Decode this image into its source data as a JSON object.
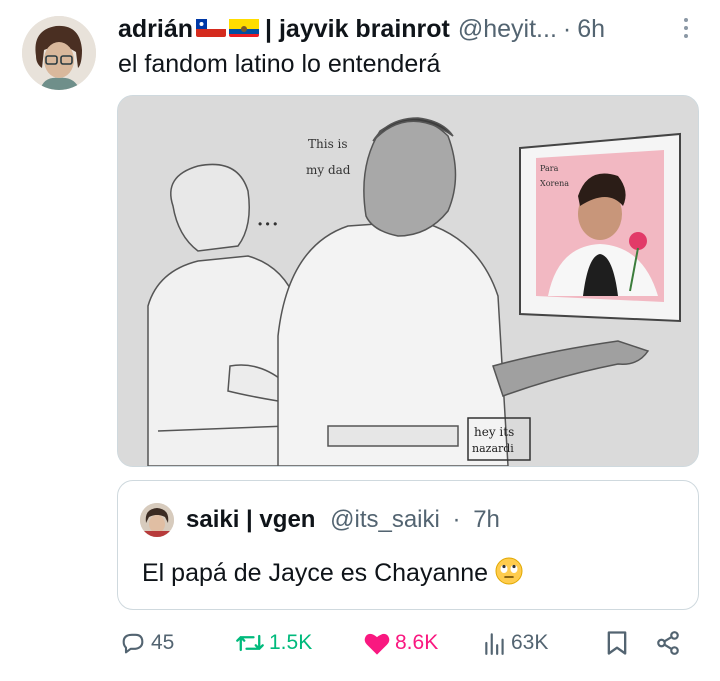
{
  "tweet": {
    "author_name": "adrián",
    "separator_name": "| jayvik brainrot",
    "handle": "@heyit...",
    "dot": "·",
    "time": "6h",
    "text": "el fandom latino lo entenderá",
    "flags": [
      "chile-flag-icon",
      "ecuador-flag-icon"
    ]
  },
  "media": {
    "speech_line1": "This is",
    "speech_line2": "my dad",
    "ellipsis": "• • •",
    "frame_note1": "Para",
    "frame_note2": "Xorena",
    "signature_line1": "hey its",
    "signature_line2": "nazardi"
  },
  "quote": {
    "author_name": "saiki | vgen",
    "handle": "@its_saiki",
    "dot": "·",
    "time": "7h",
    "text": "El papá de Jayce es Chayanne"
  },
  "actions": {
    "replies": "45",
    "retweets": "1.5K",
    "likes": "8.6K",
    "views": "63K"
  },
  "colors": {
    "retweet": "#00ba7c",
    "like": "#f91880",
    "muted": "#536471"
  }
}
